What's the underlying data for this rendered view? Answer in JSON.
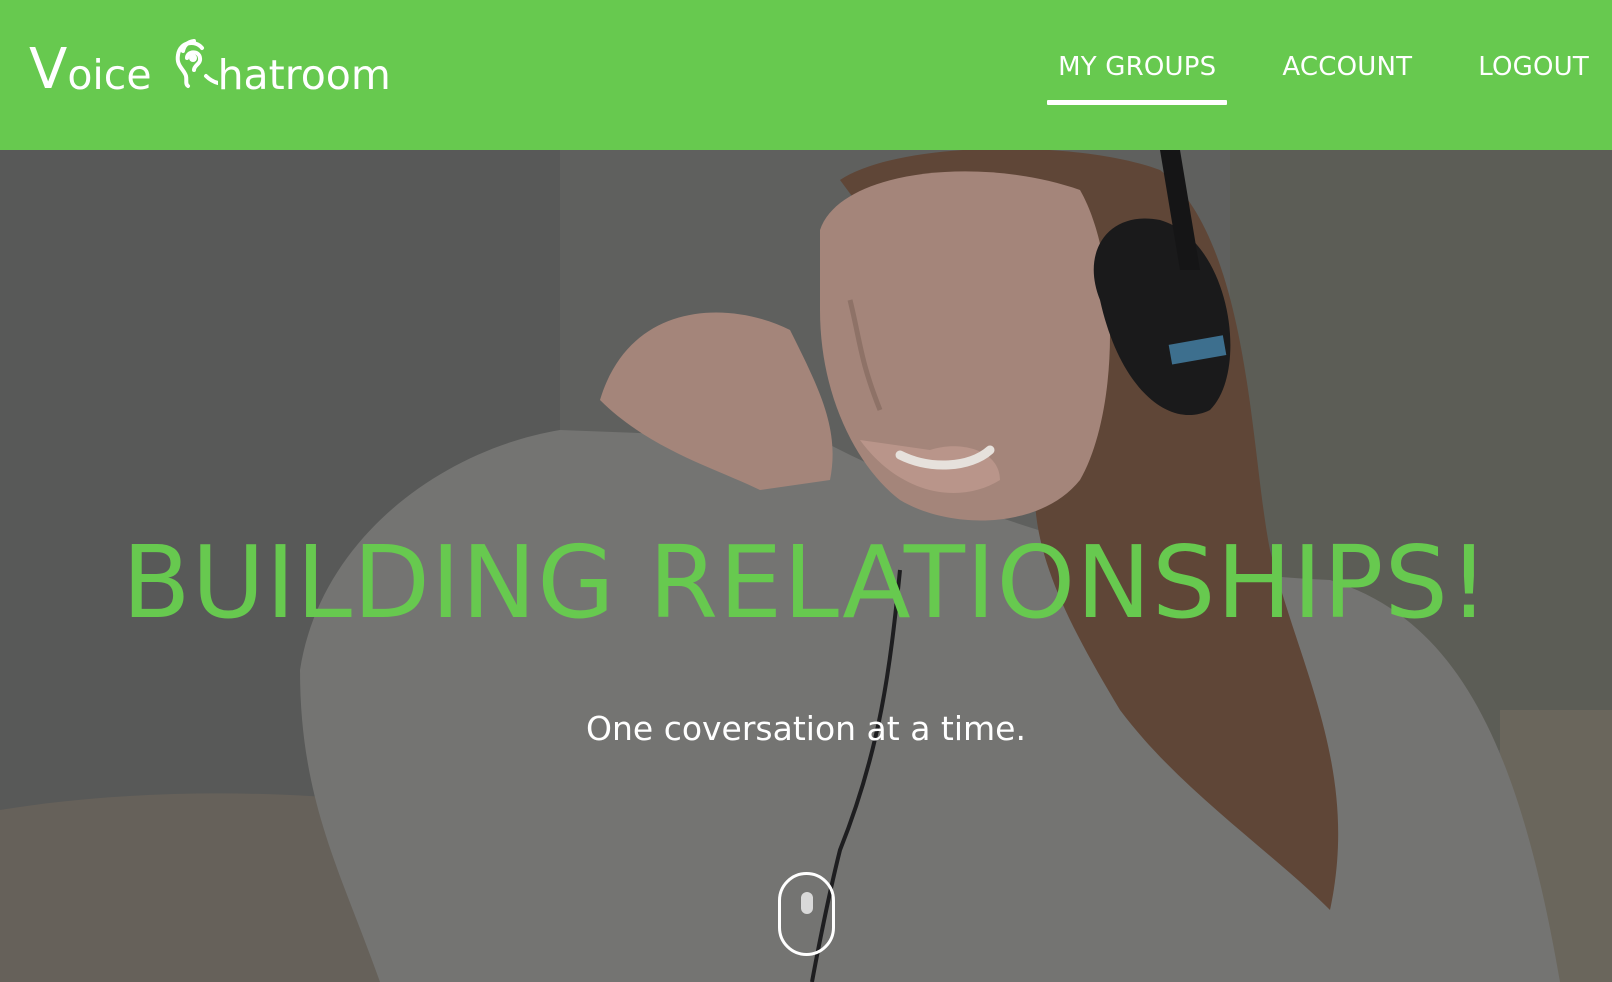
{
  "brand": {
    "first_letter": "V",
    "first_rest": "oice",
    "second_rest": "hatroom",
    "ear_icon": "ear-icon"
  },
  "nav": {
    "items": [
      {
        "label": "MY GROUPS",
        "active": true
      },
      {
        "label": "ACCOUNT",
        "active": false
      },
      {
        "label": "LOGOUT",
        "active": false
      }
    ]
  },
  "hero": {
    "title": "BUILDING RELATIONSHIPS!",
    "subtitle": "One coversation at a time.",
    "scroll_icon": "mouse-scroll-icon"
  },
  "colors": {
    "brand_green": "#67c94f",
    "text_white": "#ffffff",
    "overlay": "#5c5c5a"
  }
}
